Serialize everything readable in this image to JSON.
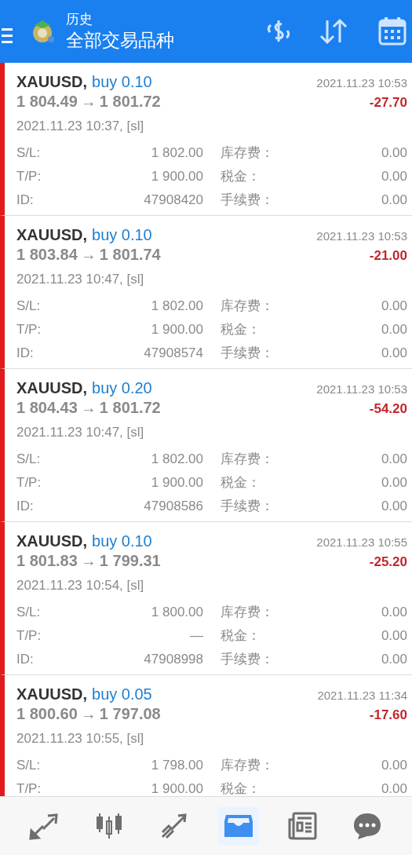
{
  "header": {
    "title": "历史",
    "subtitle": "全部交易品种"
  },
  "deals": [
    {
      "symbol": "XAUUSD,",
      "side": "buy 0.10",
      "close_time": "2021.11.23 10:53",
      "open_price": "1 804.49",
      "arrow": "→",
      "close_price": "1 801.72",
      "profit": "-27.70",
      "open_info": "2021.11.23 10:37, [sl]",
      "fields": [
        {
          "label": "S/L:",
          "value": "1 802.00",
          "label2": "库存费：",
          "value2": "0.00"
        },
        {
          "label": "T/P:",
          "value": "1 900.00",
          "label2": "税金：",
          "value2": "0.00"
        },
        {
          "label": "ID:",
          "value": "47908420",
          "label2": "手续费：",
          "value2": "0.00"
        }
      ]
    },
    {
      "symbol": "XAUUSD,",
      "side": "buy 0.10",
      "close_time": "2021.11.23 10:53",
      "open_price": "1 803.84",
      "arrow": "→",
      "close_price": "1 801.74",
      "profit": "-21.00",
      "open_info": "2021.11.23 10:47, [sl]",
      "fields": [
        {
          "label": "S/L:",
          "value": "1 802.00",
          "label2": "库存费：",
          "value2": "0.00"
        },
        {
          "label": "T/P:",
          "value": "1 900.00",
          "label2": "税金：",
          "value2": "0.00"
        },
        {
          "label": "ID:",
          "value": "47908574",
          "label2": "手续费：",
          "value2": "0.00"
        }
      ]
    },
    {
      "symbol": "XAUUSD,",
      "side": "buy 0.20",
      "close_time": "2021.11.23 10:53",
      "open_price": "1 804.43",
      "arrow": "→",
      "close_price": "1 801.72",
      "profit": "-54.20",
      "open_info": "2021.11.23 10:47, [sl]",
      "fields": [
        {
          "label": "S/L:",
          "value": "1 802.00",
          "label2": "库存费：",
          "value2": "0.00"
        },
        {
          "label": "T/P:",
          "value": "1 900.00",
          "label2": "税金：",
          "value2": "0.00"
        },
        {
          "label": "ID:",
          "value": "47908586",
          "label2": "手续费：",
          "value2": "0.00"
        }
      ]
    },
    {
      "symbol": "XAUUSD,",
      "side": "buy 0.10",
      "close_time": "2021.11.23 10:55",
      "open_price": "1 801.83",
      "arrow": "→",
      "close_price": "1 799.31",
      "profit": "-25.20",
      "open_info": "2021.11.23 10:54, [sl]",
      "fields": [
        {
          "label": "S/L:",
          "value": "1 800.00",
          "label2": "库存费：",
          "value2": "0.00"
        },
        {
          "label": "T/P:",
          "value": "—",
          "label2": "税金：",
          "value2": "0.00"
        },
        {
          "label": "ID:",
          "value": "47908998",
          "label2": "手续费：",
          "value2": "0.00"
        }
      ]
    },
    {
      "symbol": "XAUUSD,",
      "side": "buy 0.05",
      "close_time": "2021.11.23 11:34",
      "open_price": "1 800.60",
      "arrow": "→",
      "close_price": "1 797.08",
      "profit": "-17.60",
      "open_info": "2021.11.23 10:55, [sl]",
      "fields": [
        {
          "label": "S/L:",
          "value": "1 798.00",
          "label2": "库存费：",
          "value2": "0.00"
        },
        {
          "label": "T/P:",
          "value": "1 900.00",
          "label2": "税金：",
          "value2": "0.00"
        }
      ]
    }
  ],
  "nav": [
    {
      "kind": "trade",
      "selected": false
    },
    {
      "kind": "quotes",
      "selected": false
    },
    {
      "kind": "chart",
      "selected": false
    },
    {
      "kind": "history",
      "selected": true
    },
    {
      "kind": "news",
      "selected": false
    },
    {
      "kind": "chat",
      "selected": false
    }
  ]
}
